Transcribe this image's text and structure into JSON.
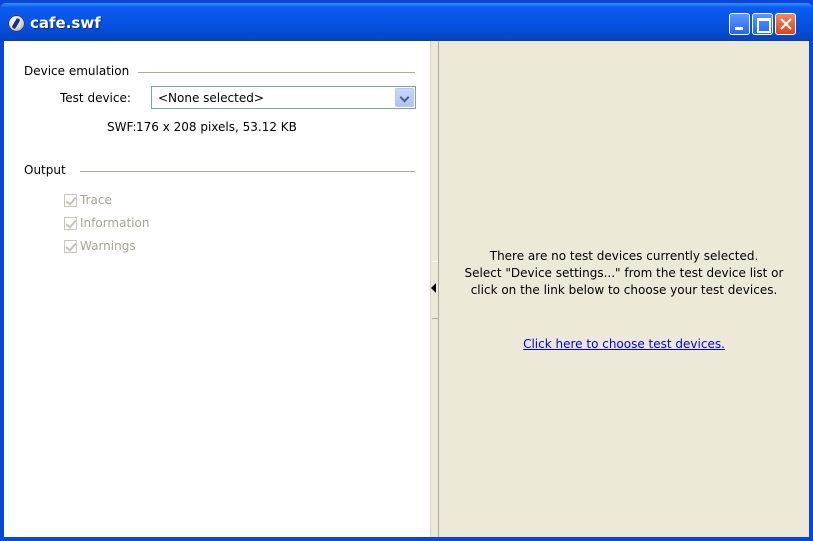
{
  "window": {
    "title": "cafe.swf"
  },
  "device_emulation": {
    "heading": "Device emulation",
    "test_device_label": "Test device:",
    "test_device_value": "<None selected>",
    "swf_label": "SWF:",
    "swf_value": "176 x 208 pixels, 53.12 KB"
  },
  "output": {
    "heading": "Output",
    "options": [
      {
        "label": "Trace",
        "checked": true,
        "enabled": false
      },
      {
        "label": "Information",
        "checked": true,
        "enabled": false
      },
      {
        "label": "Warnings",
        "checked": true,
        "enabled": false
      }
    ]
  },
  "right_panel": {
    "message_lines": [
      "There are no test devices currently selected.",
      "Select \"Device settings...\" from the test device list or",
      "click on the link below to choose your test devices."
    ],
    "link_text": "Click here to choose test devices."
  }
}
